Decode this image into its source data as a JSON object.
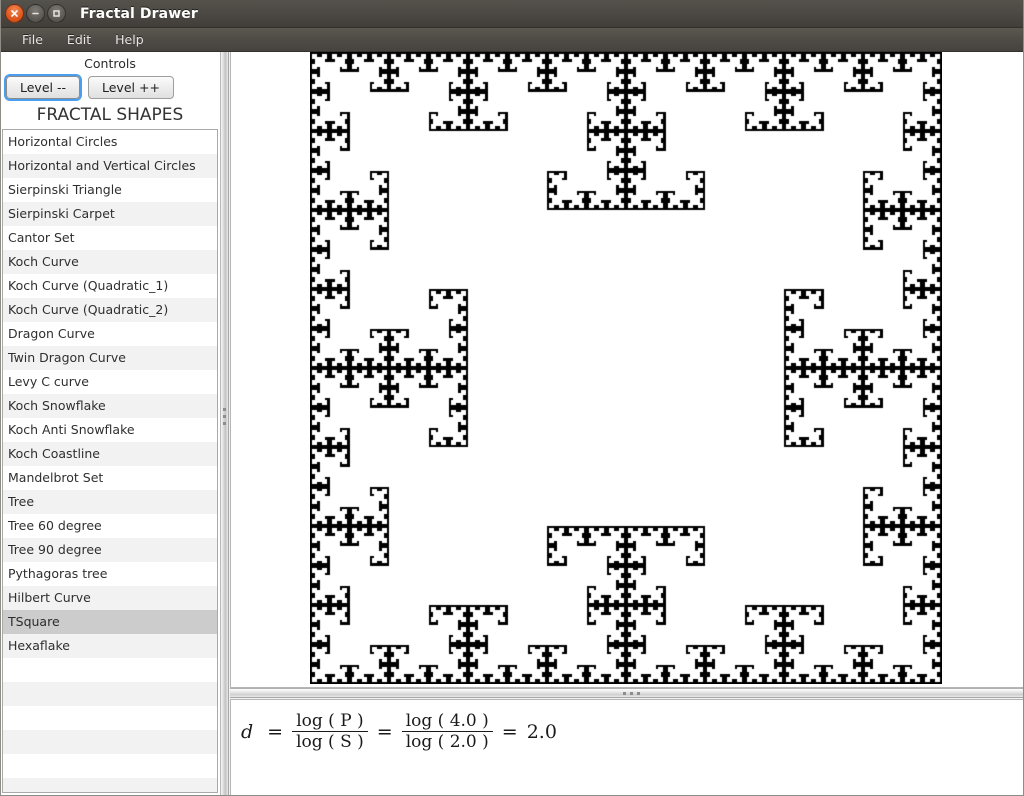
{
  "window": {
    "title": "Fractal Drawer",
    "buttons": [
      {
        "name": "close",
        "icon": "close-icon",
        "label": "Close"
      },
      {
        "name": "minimize",
        "icon": "minimize-icon",
        "label": "Minimize"
      },
      {
        "name": "maximize",
        "icon": "maximize-icon",
        "label": "Maximize"
      }
    ]
  },
  "menubar": {
    "items": [
      {
        "label": "File"
      },
      {
        "label": "Edit"
      },
      {
        "label": "Help"
      }
    ]
  },
  "controls": {
    "header": "Controls",
    "level_down_label": "Level --",
    "level_up_label": "Level ++",
    "focused_button": "Level --"
  },
  "shapes_panel": {
    "title": "FRACTAL SHAPES",
    "selected": "TSquare",
    "items": [
      "Horizontal Circles",
      "Horizontal and Vertical Circles",
      "Sierpinski Triangle",
      "Sierpinski Carpet",
      "Cantor Set",
      "Koch Curve",
      "Koch Curve (Quadratic_1)",
      "Koch Curve (Quadratic_2)",
      "Dragon Curve",
      "Twin Dragon Curve",
      "Levy C curve",
      "Koch Snowflake",
      "Koch Anti Snowflake",
      "Koch Coastline",
      "Mandelbrot Set",
      "Tree",
      "Tree 60 degree",
      "Tree 90 degree",
      "Pythagoras tree",
      "Hilbert Curve",
      "TSquare",
      "Hexaflake",
      "",
      "",
      "",
      "",
      "",
      ""
    ]
  },
  "canvas": {
    "fractal_name": "TSquare",
    "background_color": "#000000",
    "foreground_color": "#ffffff",
    "iteration_depth": 6
  },
  "formula": {
    "variable": "d",
    "equals": "=",
    "ratio_numerator": "log ( P )",
    "ratio_denominator": "log ( S )",
    "values_numerator": "log ( 4.0 )",
    "values_denominator": "log ( 2.0 )",
    "result": "2.0",
    "full_text": "d = log(P) / log(S) = log(4.0) / log(2.0) = 2.0"
  },
  "colors": {
    "titlebar": "#4c4944",
    "menubar": "#4f4c47",
    "selection": "#cccccc",
    "focus_ring": "#4a9eef",
    "list_alt_row": "#f2f2f2"
  }
}
